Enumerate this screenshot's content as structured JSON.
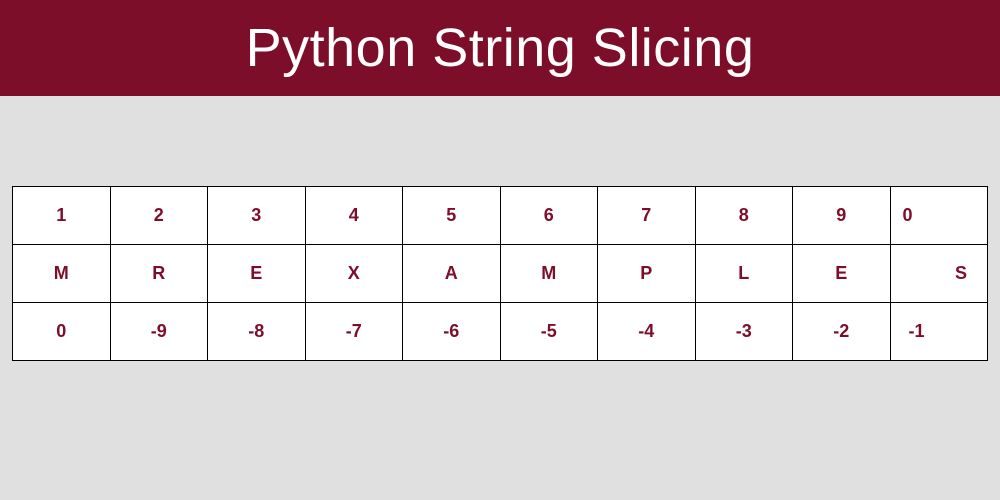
{
  "header": {
    "title": "Python String Slicing"
  },
  "table": {
    "positive_indices": [
      "1",
      "2",
      "3",
      "4",
      "5",
      "6",
      "7",
      "8",
      "9",
      "0"
    ],
    "characters": [
      "M",
      "R",
      "E",
      "X",
      "A",
      "M",
      "P",
      "L",
      "E",
      "S"
    ],
    "negative_indices": [
      "0",
      "-9",
      "-8",
      "-7",
      "-6",
      "-5",
      "-4",
      "-3",
      "-2",
      "-1"
    ]
  },
  "colors": {
    "header_bg": "#7d0e2a",
    "page_bg": "#e0e0e0",
    "cell_text": "#7d0e2a",
    "cell_border": "#000000"
  }
}
